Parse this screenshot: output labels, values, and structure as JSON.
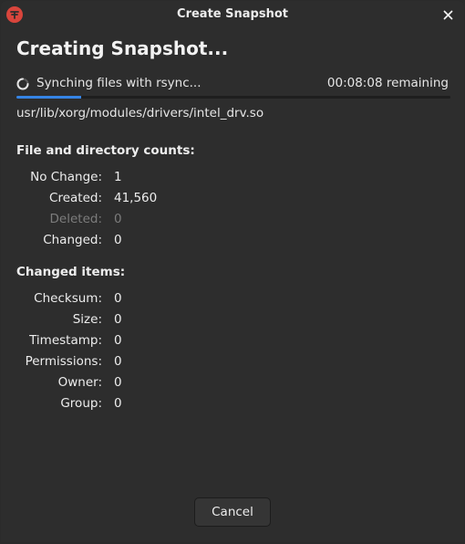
{
  "window": {
    "title": "Create Snapshot"
  },
  "heading": "Creating Snapshot...",
  "status": {
    "text": "Synching files with rsync...",
    "remaining": "00:08:08 remaining",
    "progress": 0.15
  },
  "current_file": "usr/lib/xorg/modules/drivers/intel_drv.so",
  "file_counts": {
    "title": "File and directory counts:",
    "rows": [
      {
        "label": "No Change:",
        "value": "1"
      },
      {
        "label": "Created:",
        "value": "41,560"
      },
      {
        "label": "Deleted:",
        "value": "0"
      },
      {
        "label": "Changed:",
        "value": "0"
      }
    ]
  },
  "changed_items": {
    "title": "Changed items:",
    "rows": [
      {
        "label": "Checksum:",
        "value": "0"
      },
      {
        "label": "Size:",
        "value": "0"
      },
      {
        "label": "Timestamp:",
        "value": "0"
      },
      {
        "label": "Permissions:",
        "value": "0"
      },
      {
        "label": "Owner:",
        "value": "0"
      },
      {
        "label": "Group:",
        "value": "0"
      }
    ]
  },
  "buttons": {
    "cancel": "Cancel"
  },
  "colors": {
    "accent": "#3584e4",
    "app_icon": "#d9453c",
    "background": "#2d2d2d"
  }
}
